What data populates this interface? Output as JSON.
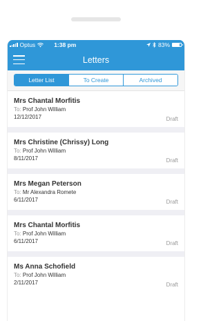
{
  "status_bar": {
    "carrier": "Optus",
    "time": "1:38 pm",
    "battery": "83%",
    "battery_level": 0.83,
    "icons": [
      "signal-icon",
      "wifi-icon",
      "location-icon",
      "bluetooth-icon",
      "battery-icon"
    ]
  },
  "nav": {
    "title": "Letters",
    "menu_icon": "hamburger-icon"
  },
  "tabs": [
    {
      "label": "Letter List",
      "active": true
    },
    {
      "label": "To Create",
      "active": false
    },
    {
      "label": "Archived",
      "active": false
    }
  ],
  "letters": [
    {
      "name": "Mrs Chantal Morfitis",
      "to_label": "To:",
      "to": "Prof John William",
      "date": "12/12/2017",
      "status": "Draft"
    },
    {
      "name": "Mrs Christine (Chrissy) Long",
      "to_label": "To:",
      "to": "Prof John William",
      "date": "8/11/2017",
      "status": "Draft"
    },
    {
      "name": "Mrs Megan Peterson",
      "to_label": "To:",
      "to": "Mr Alexandra Romete",
      "date": "6/11/2017",
      "status": "Draft"
    },
    {
      "name": "Mrs Chantal Morfitis",
      "to_label": "To:",
      "to": "Prof John William",
      "date": "6/11/2017",
      "status": "Draft"
    },
    {
      "name": "Ms Anna Schofield",
      "to_label": "To:",
      "to": "Prof John William",
      "date": "2/11/2017",
      "status": "Draft"
    }
  ],
  "colors": {
    "primary": "#2f97d8",
    "list_background": "#efeff4",
    "secondary_text": "#999999"
  }
}
